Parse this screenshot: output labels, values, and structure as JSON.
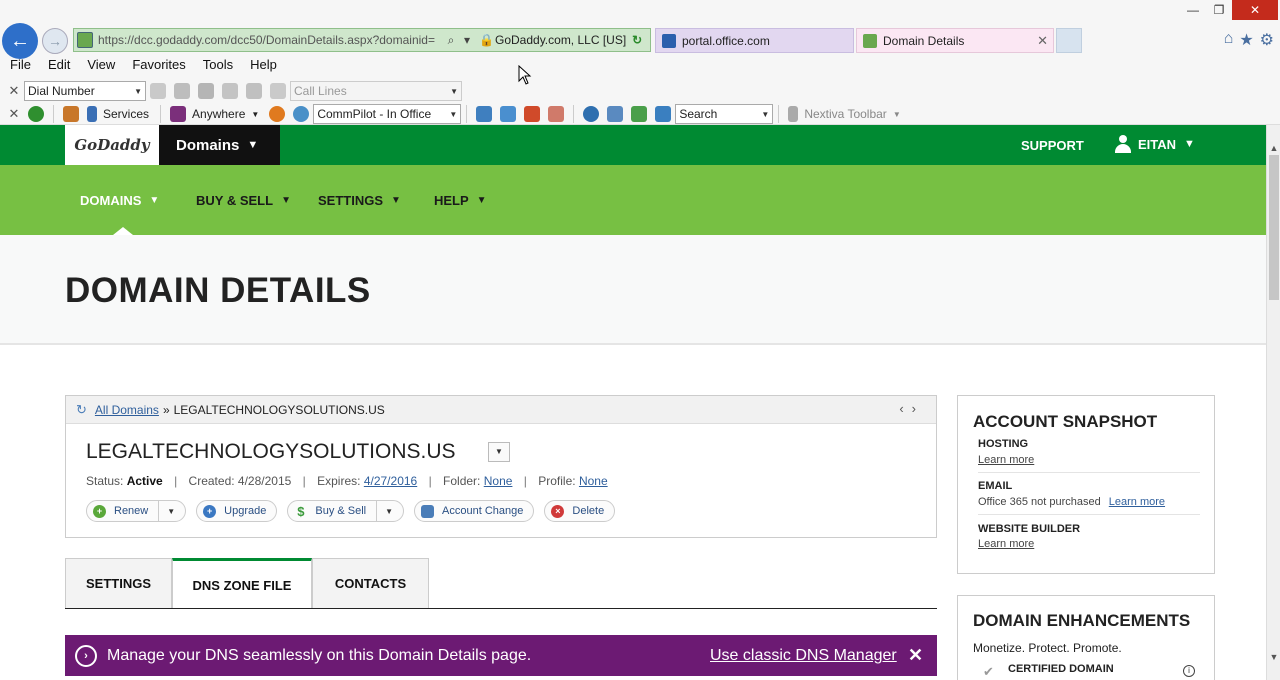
{
  "browser": {
    "url": "https://dcc.godaddy.com/dcc50/DomainDetails.aspx?domainid=",
    "cert": "GoDaddy.com, LLC [US]",
    "tabs": [
      {
        "title": "portal.office.com"
      },
      {
        "title": "Domain Details"
      }
    ],
    "menu": [
      "File",
      "Edit",
      "View",
      "Favorites",
      "Tools",
      "Help"
    ],
    "toolbar1": {
      "dial_select": "Dial Number",
      "call_lines": "Call Lines"
    },
    "toolbar2": {
      "services": "Services",
      "anywhere": "Anywhere",
      "commpilot": "CommPilot - In Office",
      "search": "Search",
      "nextiva": "Nextiva Toolbar"
    }
  },
  "site": {
    "logo": "GoDaddy",
    "product_menu": "Domains",
    "support": "SUPPORT",
    "user": "EITAN",
    "subnav": [
      "DOMAINS",
      "BUY & SELL",
      "SETTINGS",
      "HELP"
    ],
    "page_title": "DOMAIN DETAILS"
  },
  "domain": {
    "breadcrumb_link": "All Domains",
    "breadcrumb_sep": "»",
    "breadcrumb_current": "LEGALTECHNOLOGYSOLUTIONS.US",
    "name": "LEGALTECHNOLOGYSOLUTIONS.US",
    "status_label": "Status:",
    "status_value": "Active",
    "created_label": "Created:",
    "created_value": "4/28/2015",
    "expires_label": "Expires:",
    "expires_value": "4/27/2016",
    "folder_label": "Folder:",
    "folder_value": "None",
    "profile_label": "Profile:",
    "profile_value": "None",
    "actions": {
      "renew": "Renew",
      "upgrade": "Upgrade",
      "buy_sell": "Buy & Sell",
      "account_change": "Account Change",
      "delete": "Delete"
    }
  },
  "tabs": [
    "SETTINGS",
    "DNS ZONE FILE",
    "CONTACTS"
  ],
  "banner": {
    "message": "Manage your DNS seamlessly on this Domain Details page.",
    "link": "Use classic DNS Manager",
    "close": "✕"
  },
  "snapshot": {
    "title": "ACCOUNT SNAPSHOT",
    "hosting_label": "HOSTING",
    "hosting_link": "Learn more",
    "email_label": "EMAIL",
    "email_value": "Office 365 not purchased",
    "email_link": "Learn more",
    "builder_label": "WEBSITE BUILDER",
    "builder_link": "Learn more"
  },
  "enhancements": {
    "title": "DOMAIN ENHANCEMENTS",
    "tagline": "Monetize. Protect. Promote.",
    "item": "CERTIFIED DOMAIN"
  },
  "colors": {
    "godaddy_green": "#008a32",
    "subnav_green": "#77c043",
    "banner_purple": "#6c1a73"
  }
}
